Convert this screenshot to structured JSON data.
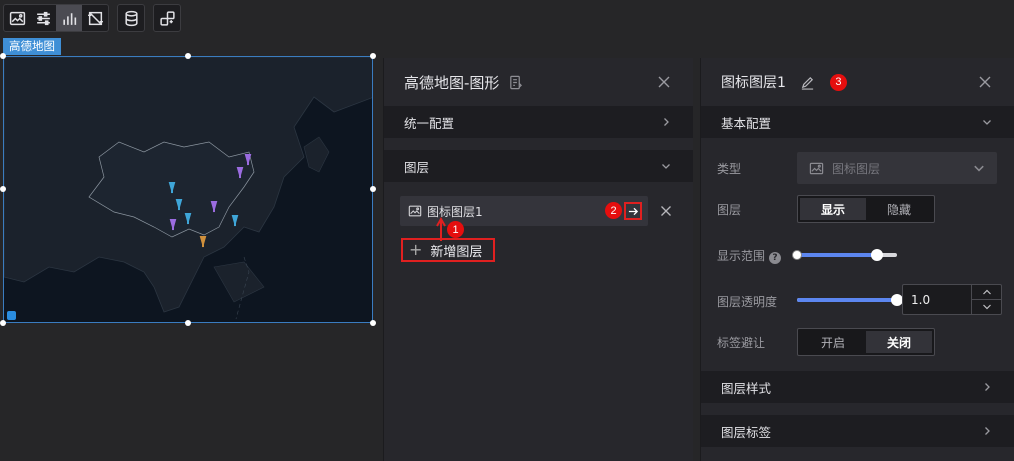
{
  "toolbar": {
    "group1": [
      {
        "name": "image-icon",
        "active": false
      },
      {
        "name": "sliders-icon",
        "active": false
      },
      {
        "name": "bar-chart-icon",
        "active": true
      },
      {
        "name": "crop-icon",
        "active": false
      }
    ],
    "group2": [
      {
        "name": "database-icon"
      }
    ],
    "group3": [
      {
        "name": "share-icon"
      }
    ]
  },
  "map_widget": {
    "tag": "高德地图"
  },
  "panel1": {
    "title": "高德地图-图形",
    "sections": {
      "unified": "统一配置",
      "layers": "图层"
    },
    "layer_item": "图标图层1",
    "add_layer": "新增图层",
    "badges": {
      "one": "1",
      "two": "2"
    }
  },
  "panel2": {
    "title": "图标图层1",
    "badge": "3",
    "basic_section": "基本配置",
    "type_label": "类型",
    "type_value": "图标图层",
    "layer_label": "图层",
    "layer_show": "显示",
    "layer_hide": "隐藏",
    "range_label": "显示范围",
    "range_help": "?",
    "range_value": [
      0,
      0.8
    ],
    "opacity_label": "图层透明度",
    "opacity_value": "1.0",
    "opacity_fraction": 1.0,
    "avoid_label": "标签避让",
    "avoid_on": "开启",
    "avoid_off": "关闭",
    "style_section": "图层样式",
    "label_section": "图层标签"
  },
  "colors": {
    "accent": "#5c86f0",
    "annotation_red": "#e02020",
    "map_bg": "#0d1520",
    "selection_blue": "#3f8fd6"
  }
}
